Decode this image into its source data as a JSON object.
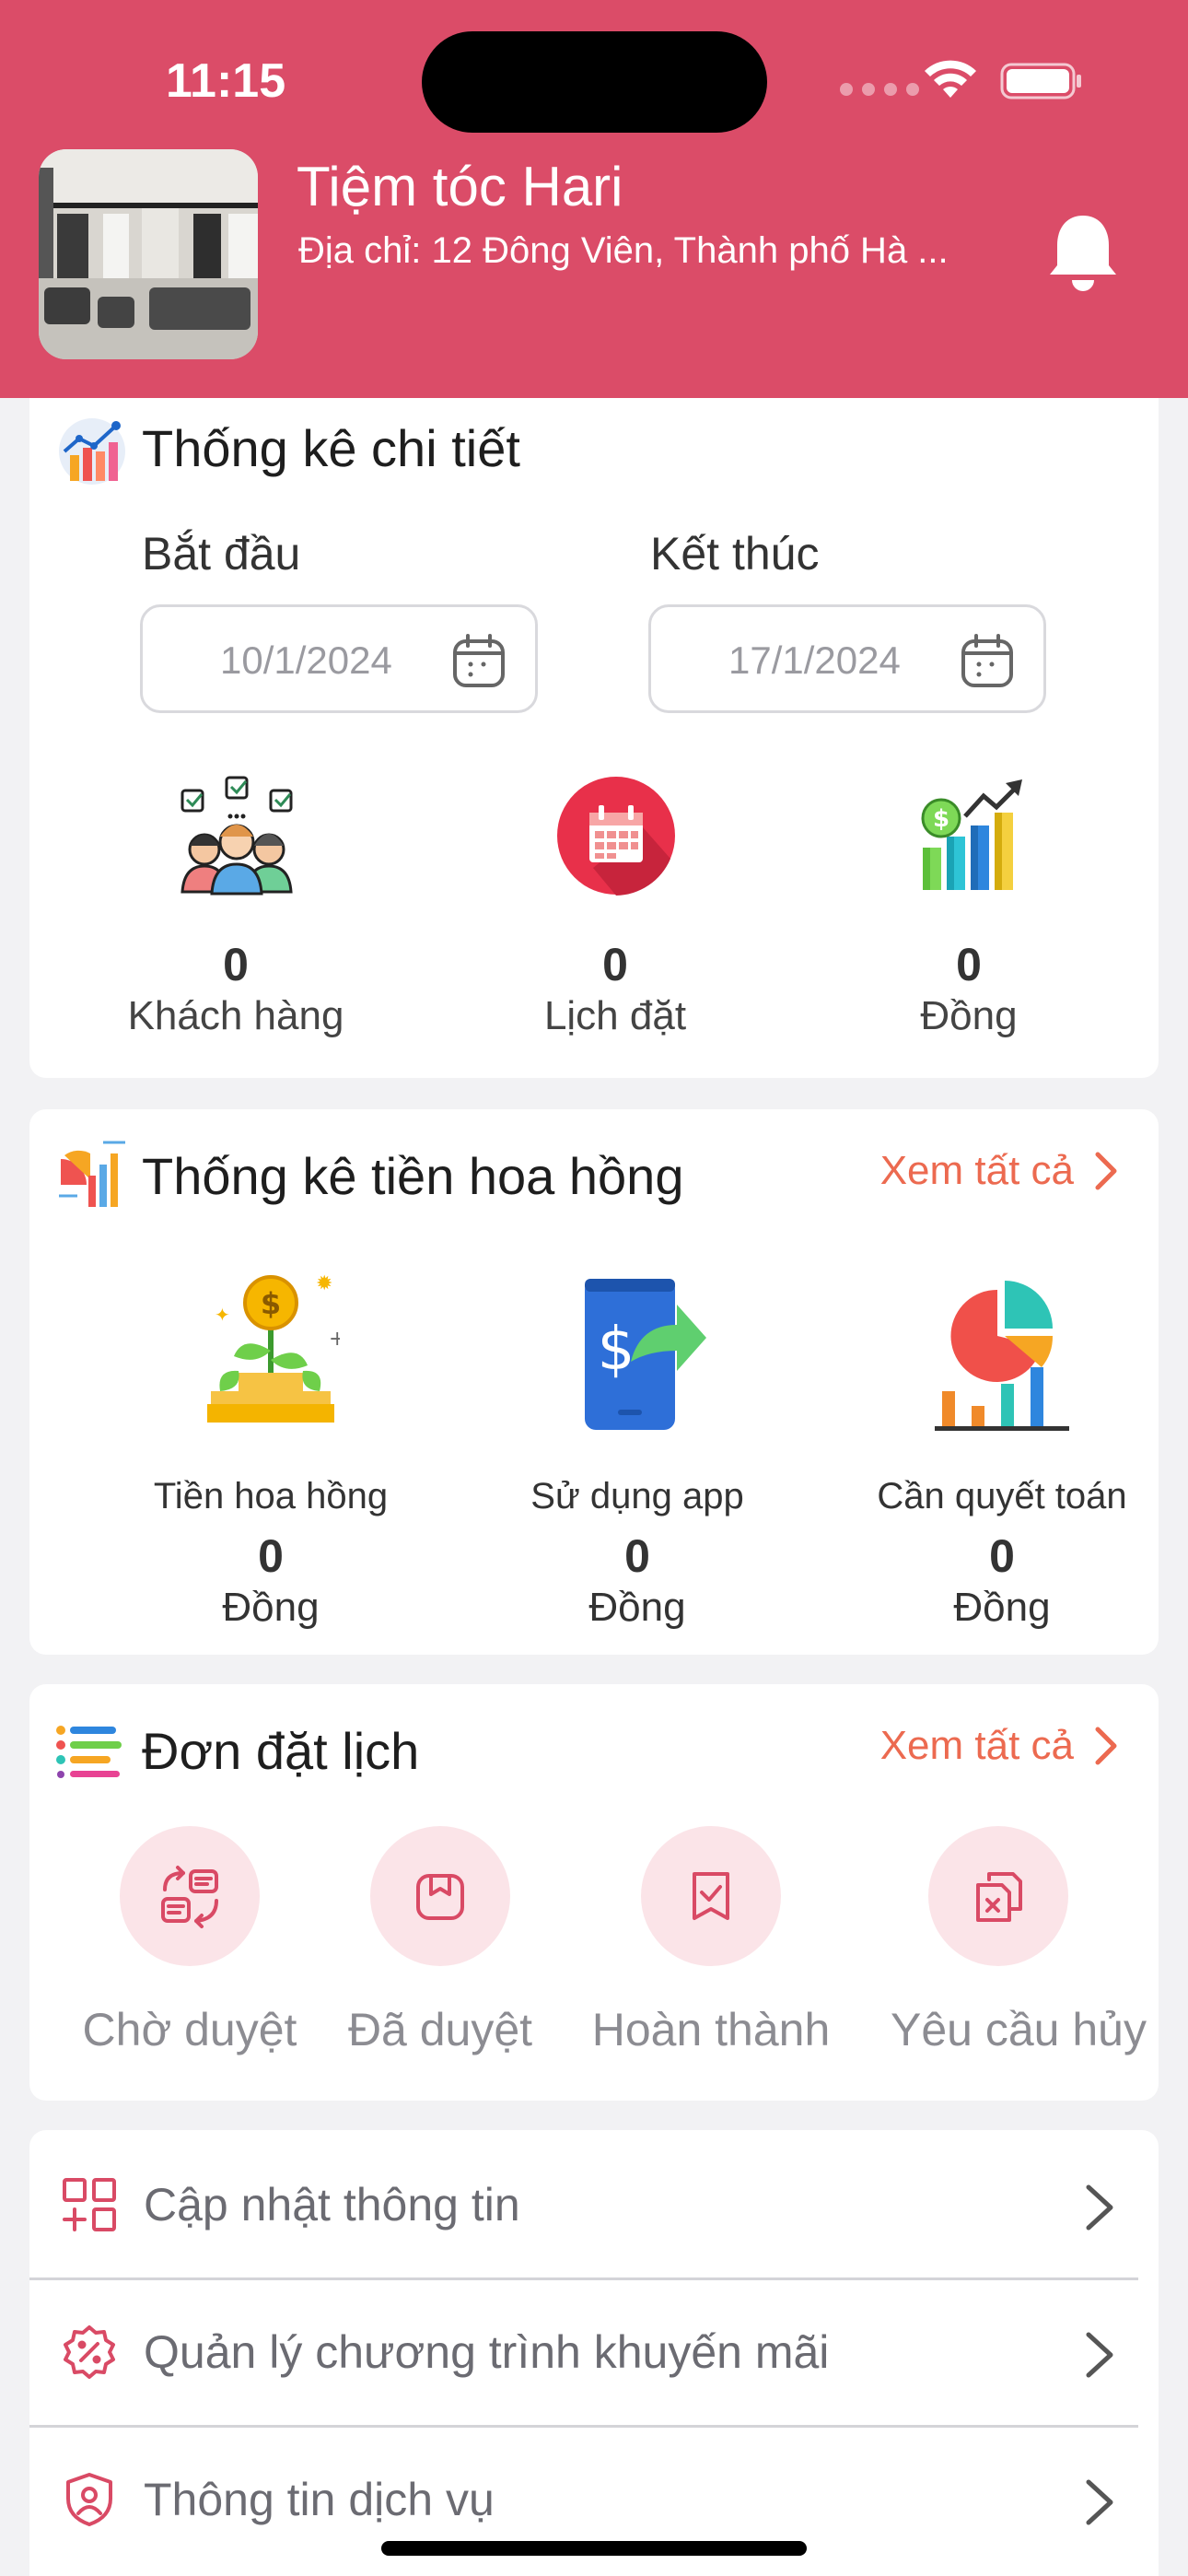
{
  "status_bar": {
    "time": "11:15"
  },
  "header": {
    "shop_name": "Tiệm tóc Hari",
    "address": "Địa chỉ: 12 Đông Viên, Thành phố Hà ..."
  },
  "stats": {
    "title": "Thống kê chi tiết",
    "start_label": "Bắt đầu",
    "end_label": "Kết thúc",
    "start_date": "10/1/2024",
    "end_date": "17/1/2024",
    "items": [
      {
        "value": "0",
        "label": "Khách hàng",
        "icon": "customers-icon"
      },
      {
        "value": "0",
        "label": "Lịch đặt",
        "icon": "calendar-icon"
      },
      {
        "value": "0",
        "label": "Đồng",
        "icon": "revenue-chart-icon"
      }
    ]
  },
  "commission": {
    "title": "Thống kê tiền hoa hồng",
    "see_all": "Xem tất cả",
    "items": [
      {
        "label": "Tiền hoa hồng",
        "value": "0",
        "unit": "Đồng",
        "icon": "money-plant-icon"
      },
      {
        "label": "Sử dụng app",
        "value": "0",
        "unit": "Đồng",
        "icon": "phone-payment-icon"
      },
      {
        "label": "Cần quyết toán",
        "value": "0",
        "unit": "Đồng",
        "icon": "pie-chart-icon"
      }
    ]
  },
  "bookings": {
    "title": "Đơn đặt lịch",
    "see_all": "Xem tất cả",
    "items": [
      {
        "label": "Chờ duyệt",
        "icon": "pending-icon"
      },
      {
        "label": "Đã duyệt",
        "icon": "approved-icon"
      },
      {
        "label": "Hoàn thành",
        "icon": "completed-icon"
      },
      {
        "label": "Yêu cầu hủy",
        "icon": "cancel-request-icon"
      }
    ]
  },
  "menu": [
    {
      "label": "Cập nhật thông tin",
      "icon": "grid-plus-icon"
    },
    {
      "label": "Quản lý chương trình khuyến mãi",
      "icon": "discount-badge-icon"
    },
    {
      "label": "Thông tin dịch vụ",
      "icon": "shield-user-icon"
    }
  ],
  "colors": {
    "header": "#db4c68",
    "accent": "#ec6a50",
    "icon_pink": "#d94a65",
    "circle_pink": "#fbe4e8"
  }
}
